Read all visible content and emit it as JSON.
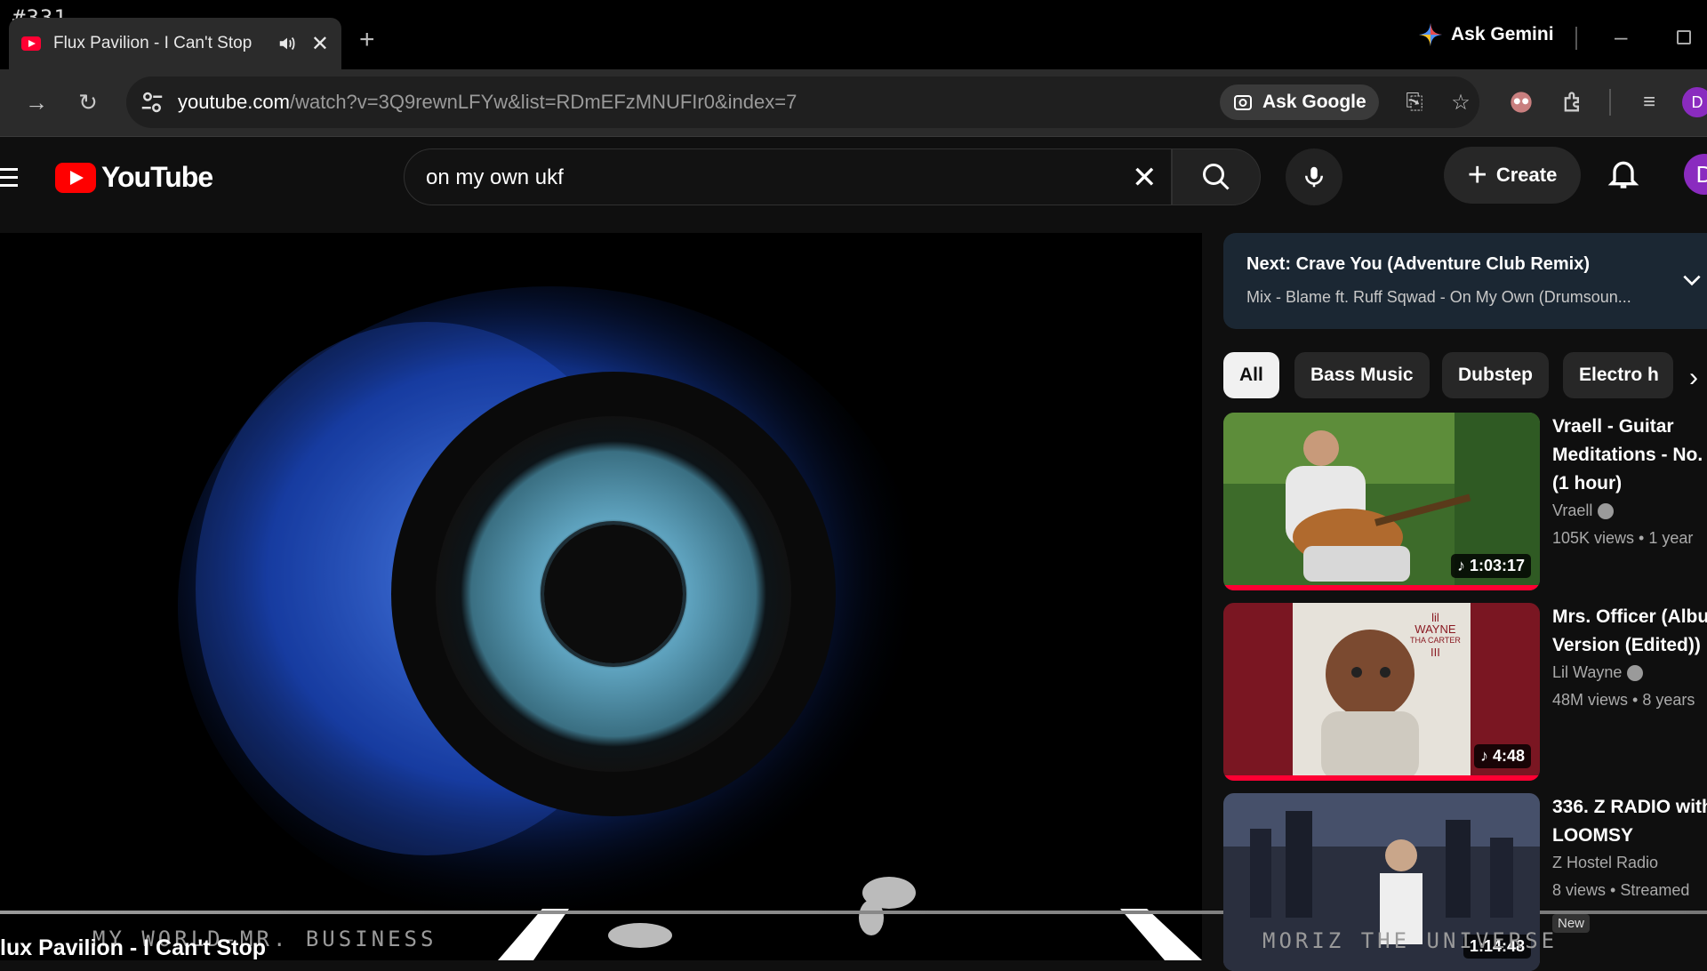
{
  "corner_label": "#331",
  "browser": {
    "tab_title": "Flux Pavilion - I Can't Stop",
    "new_tab": "+",
    "ask_gemini": "Ask Gemini",
    "url_host": "youtube.com",
    "url_path": "/watch?v=3Q9rewnLFYw&list=RDmEFzMNUFIr0&index=7",
    "ask_google": "Ask Google",
    "profile_initial": "D"
  },
  "youtube": {
    "logo_text": "YouTube",
    "search_query": "on my own ukf",
    "create_label": "Create",
    "avatar_initial": "D"
  },
  "player": {
    "overlay_left": "MY WORLD-MR. BUSINESS",
    "overlay_title": "lux Pavilion - I Can't Stop",
    "overlay_right": "MORIZ THE UNIVERSE"
  },
  "next_card": {
    "label": "Next:",
    "title": "Crave You (Adventure Club Remix)",
    "mix": "Mix - Blame ft. Ruff Sqwad - On My Own (Drumsoun..."
  },
  "chips": [
    "All",
    "Bass Music",
    "Dubstep",
    "Electro h"
  ],
  "recommendations": [
    {
      "title_lines": [
        "Vraell - Guitar",
        "Meditations - No.",
        "(1 hour)"
      ],
      "channel": "Vraell",
      "stats": "105K views • 1 year",
      "duration": "1:03:17",
      "progress": 1.0,
      "verified": true
    },
    {
      "title_lines": [
        "Mrs. Officer (Albu",
        "Version (Edited))"
      ],
      "channel": "Lil Wayne",
      "stats": "48M views • 8 years",
      "duration": "4:48",
      "progress": 1.0,
      "verified": true,
      "thumb_text": [
        "lil",
        "WAYNE",
        "THA CARTER",
        "III"
      ]
    },
    {
      "title_lines": [
        "336. Z RADIO with",
        "LOOMSY"
      ],
      "channel": "Z Hostel Radio",
      "stats": "8 views • Streamed",
      "badge": "New",
      "duration": "1:14:48",
      "progress": 0,
      "verified": false
    }
  ],
  "colors": {
    "accent_red": "#ff0033",
    "next_card_bg": "#1b2733",
    "chip_bg": "#272727"
  }
}
